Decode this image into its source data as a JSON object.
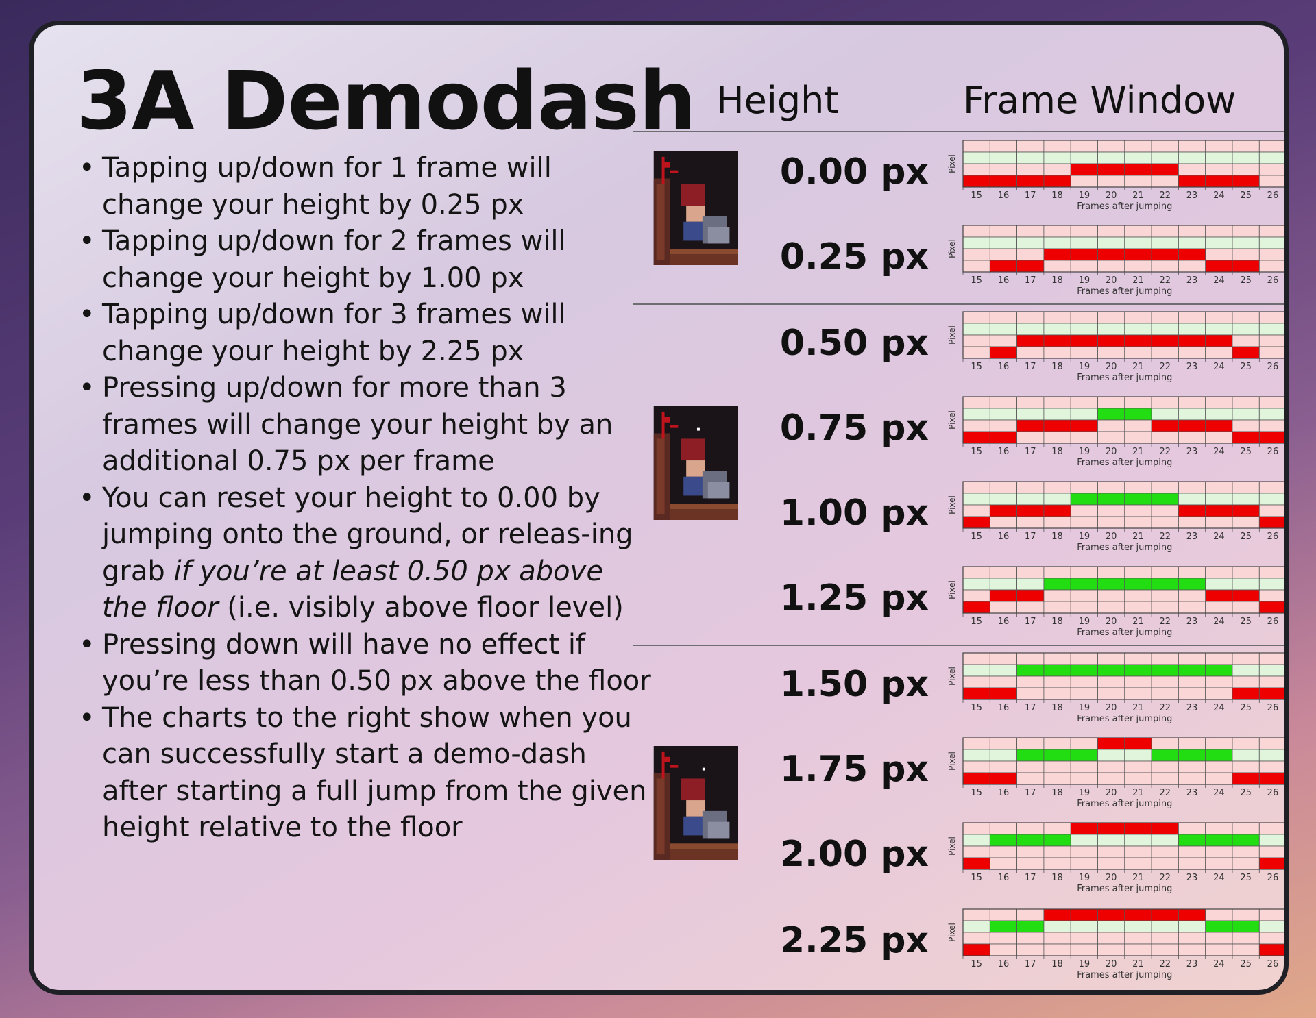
{
  "title": "3A Demodash",
  "bullets": [
    {
      "parts": [
        {
          "text": "Tapping up/down for 1 frame will change your height by 0.25 px",
          "italic": false
        }
      ]
    },
    {
      "parts": [
        {
          "text": "Tapping up/down for 2 frames will change your height by 1.00 px",
          "italic": false
        }
      ]
    },
    {
      "parts": [
        {
          "text": "Tapping up/down for 3 frames will change your height by 2.25 px",
          "italic": false
        }
      ]
    },
    {
      "parts": [
        {
          "text": "Pressing up/down for more than 3 frames will change your height by an additional 0.75 px per frame",
          "italic": false
        }
      ]
    },
    {
      "parts": [
        {
          "text": "You can reset your height to 0.00 by jumping onto the ground, or releas-ing grab ",
          "italic": false
        },
        {
          "text": "if you’re at least 0.50 px above the floor",
          "italic": true
        },
        {
          "text": " (i.e. visibly above floor level)",
          "italic": false
        }
      ]
    },
    {
      "parts": [
        {
          "text": "Pressing down will have no effect if you’re less than 0.50 px above the floor",
          "italic": false
        }
      ]
    },
    {
      "parts": [
        {
          "text": "The charts to the right show when you can successfully start a demo-dash after starting a full jump from the given height relative to the floor",
          "italic": false
        }
      ]
    }
  ],
  "columns": {
    "height": "Height",
    "frame_window": "Frame Window"
  },
  "chart_common": {
    "ylabel": "Pixel",
    "xlabel": "Frames after jumping",
    "x": [
      15,
      16,
      17,
      18,
      19,
      20,
      21,
      22,
      23,
      24,
      25,
      26
    ]
  },
  "colors": {
    "fail": "#ee0000",
    "success": "#22dd11",
    "row_light_green": "#e0f5dc",
    "row_light_red": "#fbd6d6",
    "grid": "#555555"
  },
  "chart_data": [
    {
      "type": "heatmap",
      "height_label": "0.00 px",
      "cells": [
        [
          "",
          ""
        ],
        [
          "",
          ""
        ],
        [
          "",
          ""
        ],
        [
          "",
          ""
        ],
        [
          "r",
          ""
        ],
        [
          "r",
          ""
        ],
        [
          "r",
          ""
        ],
        [
          "r",
          ""
        ],
        [
          "",
          ""
        ],
        [
          "",
          ""
        ],
        [
          "",
          ""
        ],
        [
          "",
          ""
        ]
      ],
      "states": [
        "b",
        "b",
        "b",
        "b",
        "a",
        "a",
        "a",
        "a",
        "b",
        "b",
        "b",
        "n"
      ]
    },
    {
      "type": "heatmap",
      "height_label": "0.25 px",
      "states": [
        "n",
        "b",
        "b",
        "a",
        "a",
        "a",
        "a",
        "a",
        "a",
        "b",
        "b",
        "n"
      ]
    },
    {
      "type": "heatmap",
      "height_label": "0.50 px",
      "states": [
        "n",
        "b",
        "a",
        "a",
        "a",
        "a",
        "a",
        "a",
        "a",
        "a",
        "b",
        "n"
      ]
    },
    {
      "type": "heatmap",
      "height_label": "0.75 px",
      "states": [
        "b",
        "b",
        "a",
        "a",
        "a",
        "g",
        "g",
        "a",
        "a",
        "a",
        "b",
        "b"
      ]
    },
    {
      "type": "heatmap",
      "height_label": "1.00 px",
      "states": [
        "c",
        "a",
        "a",
        "a",
        "G",
        "G",
        "G",
        "G",
        "a",
        "a",
        "a",
        "c"
      ]
    },
    {
      "type": "heatmap",
      "height_label": "1.25 px",
      "states": [
        "c",
        "a",
        "a",
        "G",
        "G",
        "G",
        "G",
        "G",
        "G",
        "a",
        "a",
        "c"
      ]
    },
    {
      "type": "heatmap",
      "height_label": "1.50 px",
      "states": [
        "c",
        "b",
        "H",
        "H",
        "H",
        "H",
        "H",
        "H",
        "H",
        "H",
        "b",
        "c"
      ]
    },
    {
      "type": "heatmap",
      "height_label": "1.75 px",
      "states": [
        "b",
        "b",
        "G",
        "G",
        "G",
        "R",
        "R",
        "G",
        "G",
        "G",
        "b",
        "b"
      ]
    },
    {
      "type": "heatmap",
      "height_label": "2.00 px",
      "states": [
        "c",
        "G",
        "G",
        "G",
        "R",
        "R",
        "R",
        "R",
        "G",
        "G",
        "G",
        "c"
      ]
    },
    {
      "type": "heatmap",
      "height_label": "2.25 px",
      "states": [
        "c",
        "G",
        "G",
        "R",
        "R",
        "R",
        "R",
        "R",
        "R",
        "G",
        "G",
        "c"
      ]
    }
  ],
  "state_legend": {
    "n": "no red",
    "a": "red row 2",
    "b": "red row 3",
    "c": "red row 4",
    "g": "green row 1, red none",
    "G": "green row 1",
    "H": "green row 0",
    "R": "red row 0"
  }
}
